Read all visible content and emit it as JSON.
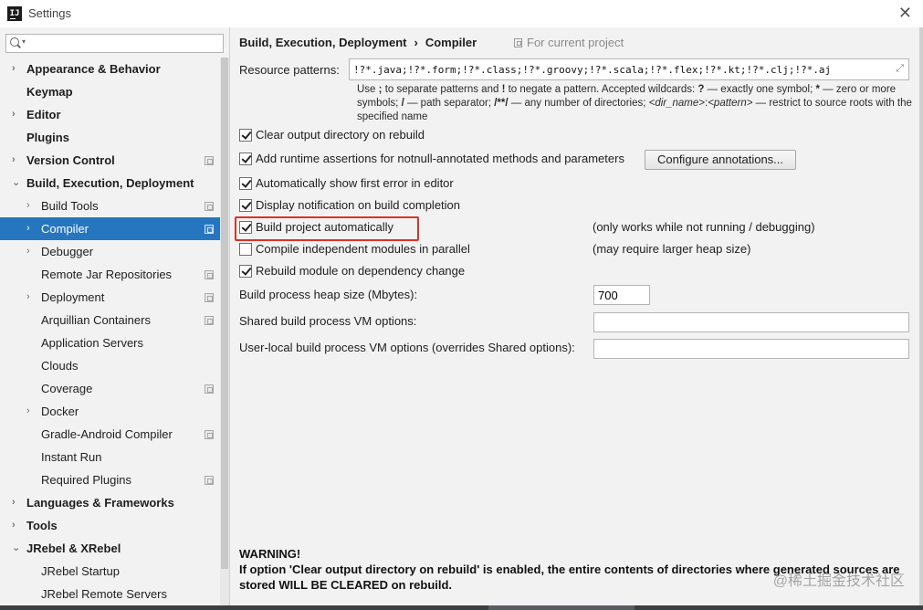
{
  "window": {
    "title": "Settings",
    "app_icon": "intellij-idea-icon",
    "close_icon": "close-icon"
  },
  "sidebar": {
    "search": {
      "value": "",
      "placeholder": ""
    },
    "items": [
      {
        "label": "Appearance & Behavior",
        "bold": true,
        "arrow": "›",
        "level": 0
      },
      {
        "label": "Keymap",
        "bold": true,
        "arrow": "",
        "level": 0
      },
      {
        "label": "Editor",
        "bold": true,
        "arrow": "›",
        "level": 0
      },
      {
        "label": "Plugins",
        "bold": true,
        "arrow": "",
        "level": 0
      },
      {
        "label": "Version Control",
        "bold": true,
        "arrow": "›",
        "level": 0,
        "project_icon": true
      },
      {
        "label": "Build, Execution, Deployment",
        "bold": true,
        "arrow": "⌄",
        "level": 0
      },
      {
        "label": "Build Tools",
        "bold": false,
        "arrow": "›",
        "level": 1,
        "project_icon": true
      },
      {
        "label": "Compiler",
        "bold": false,
        "arrow": "›",
        "level": 1,
        "project_icon": true,
        "selected": true
      },
      {
        "label": "Debugger",
        "bold": false,
        "arrow": "›",
        "level": 1
      },
      {
        "label": "Remote Jar Repositories",
        "bold": false,
        "arrow": "",
        "level": 1,
        "project_icon": true
      },
      {
        "label": "Deployment",
        "bold": false,
        "arrow": "›",
        "level": 1,
        "project_icon": true
      },
      {
        "label": "Arquillian Containers",
        "bold": false,
        "arrow": "",
        "level": 1,
        "project_icon": true
      },
      {
        "label": "Application Servers",
        "bold": false,
        "arrow": "",
        "level": 1
      },
      {
        "label": "Clouds",
        "bold": false,
        "arrow": "",
        "level": 1
      },
      {
        "label": "Coverage",
        "bold": false,
        "arrow": "",
        "level": 1,
        "project_icon": true
      },
      {
        "label": "Docker",
        "bold": false,
        "arrow": "›",
        "level": 1
      },
      {
        "label": "Gradle-Android Compiler",
        "bold": false,
        "arrow": "",
        "level": 1,
        "project_icon": true
      },
      {
        "label": "Instant Run",
        "bold": false,
        "arrow": "",
        "level": 1
      },
      {
        "label": "Required Plugins",
        "bold": false,
        "arrow": "",
        "level": 1,
        "project_icon": true
      },
      {
        "label": "Languages & Frameworks",
        "bold": true,
        "arrow": "›",
        "level": 0
      },
      {
        "label": "Tools",
        "bold": true,
        "arrow": "›",
        "level": 0
      },
      {
        "label": "JRebel & XRebel",
        "bold": true,
        "arrow": "⌄",
        "level": 0
      },
      {
        "label": "JRebel Startup",
        "bold": false,
        "arrow": "",
        "level": 1
      },
      {
        "label": "JRebel Remote Servers",
        "bold": false,
        "arrow": "",
        "level": 1
      }
    ]
  },
  "header": {
    "crumb_parent": "Build, Execution, Deployment",
    "crumb_sep": "›",
    "crumb_current": "Compiler",
    "scope": "For current project"
  },
  "resource": {
    "label": "Resource patterns:",
    "value": "!?*.java;!?*.form;!?*.class;!?*.groovy;!?*.scala;!?*.flex;!?*.kt;!?*.clj;!?*.aj",
    "hint": {
      "p1": "Use ",
      "b1": ";",
      "p2": " to separate patterns and ",
      "b2": "!",
      "p3": " to negate a pattern. Accepted wildcards: ",
      "b3": "?",
      "p4": " — exactly one symbol; ",
      "b4": "*",
      "p5": " — zero or more symbols; ",
      "b5": "/",
      "p6": " — path separator; ",
      "b6": "/**/",
      "p7": " — any number of directories; ",
      "i1": "<dir_name>",
      "p8": ":",
      "i2": "<pattern>",
      "p9": " — restrict to source roots with the specified name"
    }
  },
  "options": [
    {
      "label": "Clear output directory on rebuild",
      "checked": true
    },
    {
      "label": "Add runtime assertions for notnull-annotated methods and parameters",
      "checked": true
    },
    {
      "label": "Automatically show first error in editor",
      "checked": true
    },
    {
      "label": "Display notification on build completion",
      "checked": true
    },
    {
      "label": "Build project automatically",
      "checked": true,
      "note": "(only works while not running / debugging)"
    },
    {
      "label": "Compile independent modules in parallel",
      "checked": false,
      "note": "(may require larger heap size)"
    },
    {
      "label": "Rebuild module on dependency change",
      "checked": true
    }
  ],
  "configure_button": "Configure annotations...",
  "fields": {
    "heap_label": "Build process heap size (Mbytes):",
    "heap_value": "700",
    "shared_label": "Shared build process VM options:",
    "shared_value": "",
    "local_label": "User-local build process VM options (overrides Shared options):",
    "local_value": ""
  },
  "warning": {
    "title": "WARNING!",
    "body": "If option 'Clear output directory on rebuild' is enabled, the entire contents of directories where generated sources are stored WILL BE CLEARED on rebuild."
  },
  "watermark": "@稀土掘金技术社区",
  "colors": {
    "selection": "#2675bf",
    "highlight_box": "#d9332b"
  }
}
